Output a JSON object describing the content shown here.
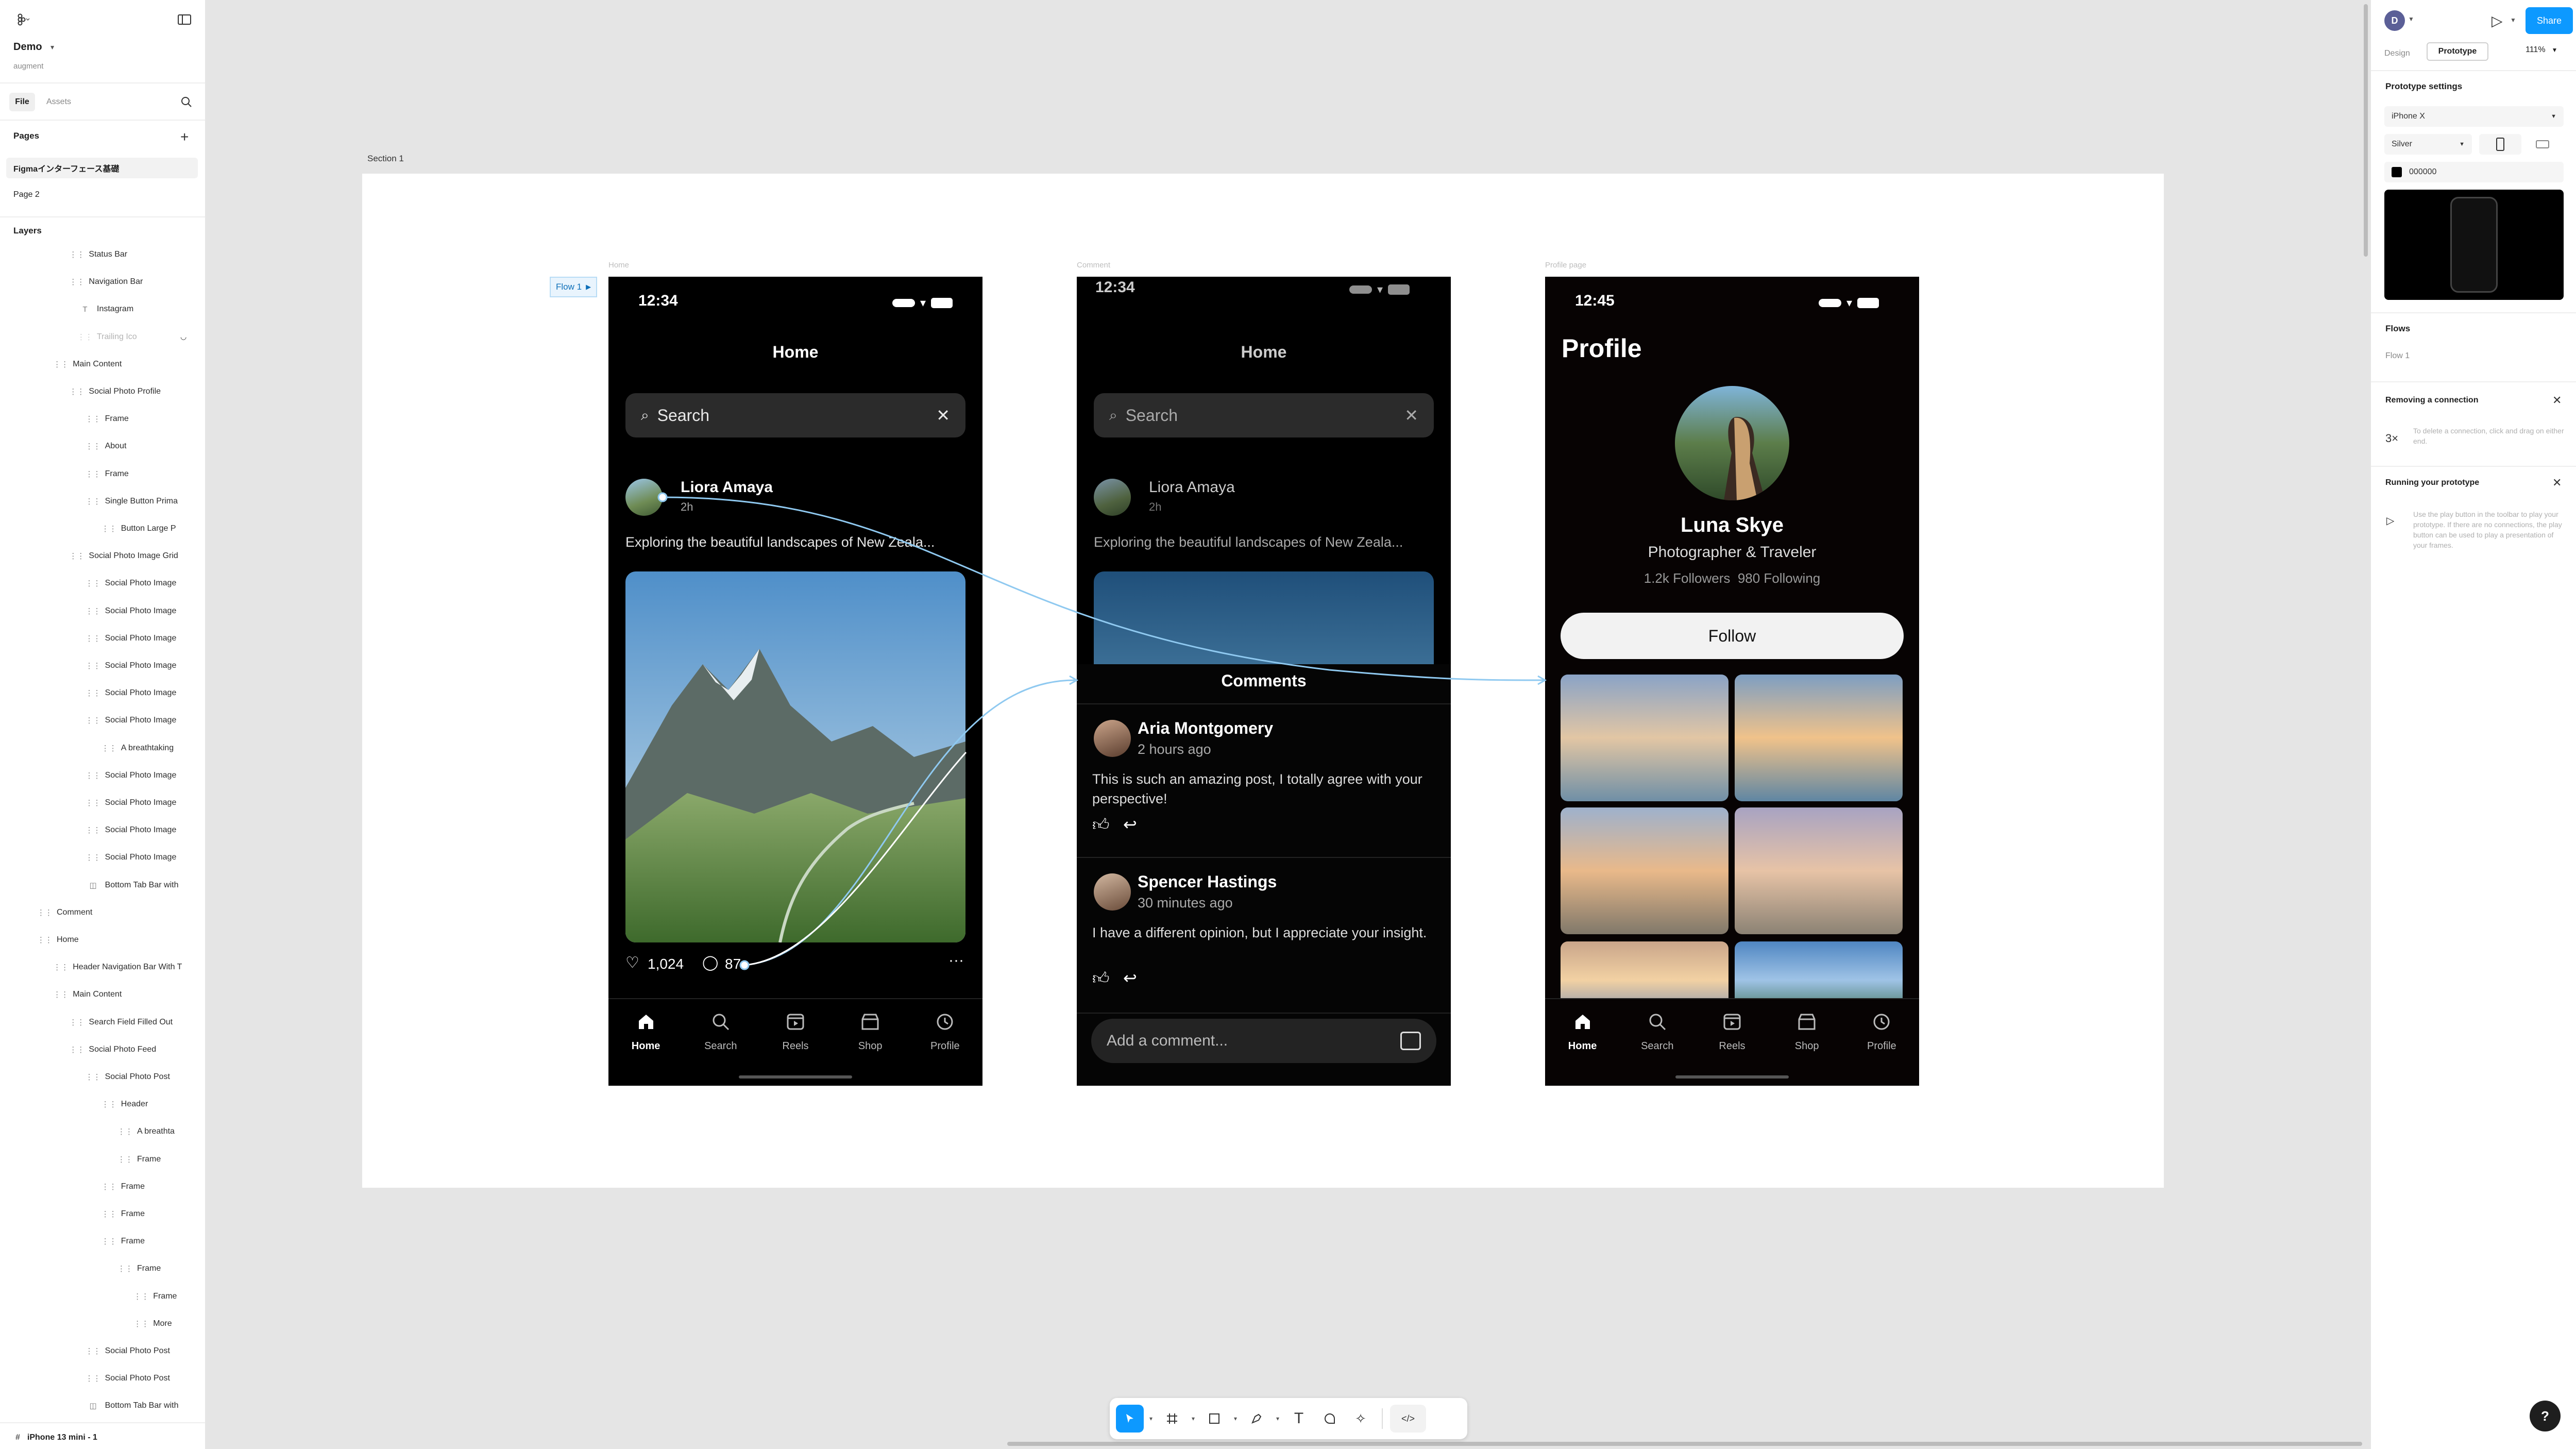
{
  "file": {
    "name": "Demo",
    "team": "augment"
  },
  "left_tabs": [
    "File",
    "Assets"
  ],
  "pages_label": "Pages",
  "pages": [
    "Figmaインターフェース基礎",
    "Page 2"
  ],
  "layers_label": "Layers",
  "layers": [
    "Status Bar",
    "Navigation Bar",
    "Instagram",
    "Trailing Ico",
    "Main Content",
    "Social Photo Profile",
    "Frame",
    "About",
    "Frame",
    "Single Button Prima",
    "Button Large P",
    "Social Photo Image Grid",
    "Social Photo Image",
    "Social Photo Image",
    "Social Photo Image",
    "Social Photo Image",
    "Social Photo Image",
    "Social Photo Image",
    "A breathtaking",
    "Social Photo Image",
    "Social Photo Image",
    "Social Photo Image",
    "Social Photo Image",
    "Bottom Tab Bar with",
    "Comment",
    "Home",
    "Header Navigation Bar With T",
    "Main Content",
    "Search Field Filled Out",
    "Social Photo Feed",
    "Social Photo Post",
    "Header",
    "A breathta",
    "Frame",
    "Frame",
    "Frame",
    "Frame",
    "Frame",
    "Frame",
    "More",
    "Social Photo Post",
    "Social Photo Post",
    "Bottom Tab Bar with"
  ],
  "footer_layer": "iPhone 13 mini - 1",
  "canvas": {
    "section_label": "Section 1",
    "flow_badge": "Flow 1",
    "frame_labels": [
      "Home",
      "Comment",
      "Profile page"
    ]
  },
  "home_frame": {
    "time": "12:34",
    "title": "Home",
    "search": "Search",
    "post": {
      "user": "Liora Amaya",
      "time": "2h",
      "caption": "Exploring the beautiful landscapes of New Zeala...",
      "likes": "1,024",
      "comments": "87"
    }
  },
  "comment_frame": {
    "time": "12:34",
    "title": "Home",
    "search": "Search",
    "post": {
      "user": "Liora Amaya",
      "time": "2h",
      "caption": "Exploring the beautiful landscapes of New Zeala..."
    },
    "sheet_title": "Comments",
    "comments": [
      {
        "name": "Aria Montgomery",
        "time": "2 hours ago",
        "text": "This is such an amazing post, I totally agree with your perspective!"
      },
      {
        "name": "Spencer Hastings",
        "time": "30 minutes ago",
        "text": "I have a different opinion, but I appreciate your insight."
      }
    ],
    "add_placeholder": "Add a comment..."
  },
  "profile_frame": {
    "time": "12:45",
    "title": "Profile",
    "name": "Luna Skye",
    "bio": "Photographer & Traveler",
    "stats": "1.2k Followers  980 Following",
    "follow": "Follow"
  },
  "tabs": [
    "Home",
    "Search",
    "Reels",
    "Shop",
    "Profile"
  ],
  "right": {
    "avatar_letter": "D",
    "share": "Share",
    "mode_tabs": [
      "Design",
      "Prototype"
    ],
    "zoom": "111%",
    "settings_title": "Prototype settings",
    "device": "iPhone X",
    "color_model": "Silver",
    "bg_hex": "000000",
    "flows_title": "Flows",
    "flow_item": "Flow 1",
    "tip1_title": "Removing a connection",
    "tip1_text": "To delete a connection, click and drag on either end.",
    "tip2_title": "Running your prototype",
    "tip2_text": "Use the play button in the toolbar to play your prototype. If there are no connections, the play button can be used to play a presentation of your frames."
  },
  "help": "?",
  "colors": {
    "accent": "#0d99ff",
    "flow": "#8fc9f0"
  }
}
